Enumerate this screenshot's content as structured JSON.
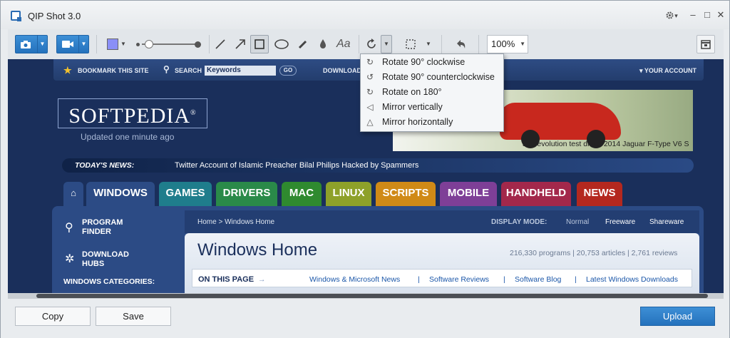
{
  "app": {
    "title": "QIP Shot 3.0"
  },
  "window_controls": {
    "settings_arrow": "▾",
    "minimize": "–",
    "maximize": "□",
    "close": "✕"
  },
  "toolbar": {
    "zoom": "100%"
  },
  "rotate_menu": {
    "items": [
      "Rotate 90° clockwise",
      "Rotate 90° counterclockwise",
      "Rotate on 180°",
      "Mirror vertically",
      "Mirror horizontally"
    ]
  },
  "page": {
    "top_links": {
      "bookmark": "BOOKMARK THIS SITE",
      "search": "SEARCH",
      "keywords": "Keywords",
      "go": "GO",
      "downloads": "DOWNLOADS",
      "account": "▾ YOUR ACCOUNT"
    },
    "logo": "SOFTPEDIA",
    "logo_mark": "®",
    "updated": "Updated one minute ago",
    "banner_caption": "autoevolution test drive: 2014 Jaguar F-Type V6 S",
    "news_label": "TODAY'S NEWS:",
    "news_text": "Twitter Account of Islamic Preacher Bilal Philips Hacked by Spammers",
    "tabs": [
      {
        "label": "WINDOWS",
        "color": "#2c4b85"
      },
      {
        "label": "GAMES",
        "color": "#1f7d8c"
      },
      {
        "label": "DRIVERS",
        "color": "#2a8a49"
      },
      {
        "label": "MAC",
        "color": "#2f8a2f"
      },
      {
        "label": "LINUX",
        "color": "#8ea12a"
      },
      {
        "label": "SCRIPTS",
        "color": "#d08a17"
      },
      {
        "label": "MOBILE",
        "color": "#7e3f97"
      },
      {
        "label": "HANDHELD",
        "color": "#a3284b"
      },
      {
        "label": "NEWS",
        "color": "#b4281f"
      }
    ],
    "side": {
      "program_finder": "PROGRAM FINDER",
      "download_hubs": "DOWNLOAD HUBS",
      "windows_categories": "WINDOWS CATEGORIES:"
    },
    "breadcrumb": "Home > Windows Home",
    "display_mode": "DISPLAY MODE:",
    "modes": [
      "Normal",
      "Freeware",
      "Shareware"
    ],
    "heading": "Windows Home",
    "stats": "216,330 programs | 20,753 articles | 2,761 reviews",
    "on_this_page": "ON THIS PAGE",
    "otp_arrow": "→",
    "otp_links": [
      "Windows & Microsoft News",
      "Software Reviews",
      "Software Blog",
      "Latest Windows Downloads"
    ]
  },
  "bottom": {
    "copy": "Copy",
    "save": "Save",
    "upload": "Upload"
  }
}
